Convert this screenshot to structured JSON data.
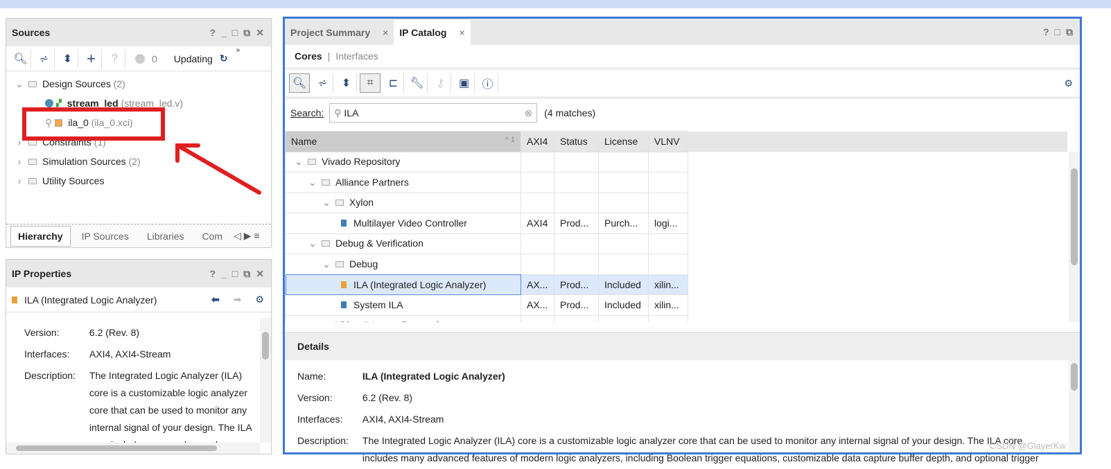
{
  "sources": {
    "title": "Sources",
    "window_buttons": [
      "?",
      "_",
      "□",
      "⧉",
      "✕"
    ],
    "status_count": "0",
    "status_text": "Updating",
    "tree": [
      {
        "label": "Design Sources",
        "count": "(2)",
        "expanded": true
      },
      {
        "label": "stream_led",
        "file": "(stream_led.v)"
      },
      {
        "label": "ila_0",
        "file": "(ila_0.xci)"
      },
      {
        "label": "Constraints",
        "count": "(1)"
      },
      {
        "label": "Simulation Sources",
        "count": "(2)"
      },
      {
        "label": "Utility Sources",
        "count": ""
      }
    ],
    "tabs": [
      "Hierarchy",
      "IP Sources",
      "Libraries",
      "Com"
    ]
  },
  "ip_properties": {
    "title": "IP Properties",
    "ip_name": "ILA (Integrated Logic Analyzer)",
    "version_label": "Version:",
    "version": "6.2 (Rev. 8)",
    "interfaces_label": "Interfaces:",
    "interfaces": "AXI4, AXI4-Stream",
    "description_label": "Description:",
    "description": "The Integrated Logic Analyzer (ILA) core is a customizable logic analyzer core that can be used to monitor any internal signal of your design. The ILA core includes many advanced features of modern logic analyzers, including"
  },
  "main": {
    "tabs": [
      "Project Summary",
      "IP Catalog"
    ],
    "subtabs": [
      "Cores",
      "Interfaces"
    ],
    "search_label": "Search:",
    "search_value": "ILA",
    "matches": "(4 matches)",
    "columns": [
      "Name",
      "AXI4",
      "Status",
      "License",
      "VLNV"
    ],
    "sort_indicator": "^ 1",
    "rows": [
      {
        "name": "Vivado Repository",
        "level": 0,
        "folder": true
      },
      {
        "name": "Alliance Partners",
        "level": 1,
        "folder": true
      },
      {
        "name": "Xylon",
        "level": 2,
        "folder": true
      },
      {
        "name": "Multilayer Video Controller",
        "level": 3,
        "axi4": "AXI4",
        "status": "Prod...",
        "license": "Purch...",
        "vlnv": "logi..."
      },
      {
        "name": "Debug & Verification",
        "level": 1,
        "folder": true
      },
      {
        "name": "Debug",
        "level": 2,
        "folder": true
      },
      {
        "name": "ILA (Integrated Logic Analyzer)",
        "level": 3,
        "axi4": "AX...",
        "status": "Prod...",
        "license": "Included",
        "vlnv": "xilin...",
        "selected": true
      },
      {
        "name": "System ILA",
        "level": 3,
        "axi4": "AX...",
        "status": "Prod...",
        "license": "Included",
        "vlnv": "xilin..."
      },
      {
        "name": "Video & Image Processing",
        "level": 1,
        "folder": true
      }
    ],
    "details": {
      "title": "Details",
      "name_label": "Name:",
      "name": "ILA (Integrated Logic Analyzer)",
      "version_label": "Version:",
      "version": "6.2 (Rev. 8)",
      "interfaces_label": "Interfaces:",
      "interfaces": "AXI4, AXI4-Stream",
      "description_label": "Description:",
      "description": "The Integrated Logic Analyzer (ILA) core is a customizable logic analyzer core that can be used to monitor any internal signal of your design. The ILA core includes many advanced features of modern logic analyzers, including Boolean trigger equations, customizable data capture buffer depth, and optional trigger"
    },
    "watermark": "CSDN @GlayerKw"
  },
  "colors": {
    "accent_border": "#3f78d4",
    "annotation": "#e02020",
    "selection": "#dce8fb"
  }
}
